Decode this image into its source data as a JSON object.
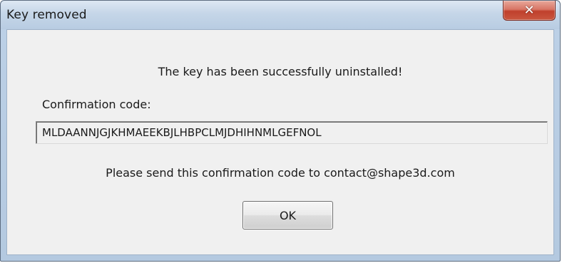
{
  "window": {
    "title": "Key removed",
    "close_icon": "close-icon",
    "close_glyph": "✕",
    "close_color": "#c9563f"
  },
  "dialog": {
    "message": "The key has been successfully uninstalled!",
    "code_label": "Confirmation code:",
    "code_value": "MLDAANNJGJKHMAEEKBJLHBPCLMJDHIHNMLGEFNOL",
    "instruction": "Please send this confirmation code to contact@shape3d.com",
    "ok_label": "OK"
  }
}
